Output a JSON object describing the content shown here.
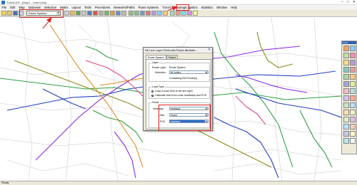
{
  "window": {
    "title": "TransCAD - [Map1 - Live# plan]",
    "buttons": [
      "–",
      "□",
      "✕"
    ]
  },
  "menu": [
    "File",
    "Edit",
    "Map",
    "Dataview",
    "Selection",
    "Matrix",
    "Layout",
    "Tools",
    "Procedures",
    "Networks/Paths",
    "Route Systems",
    "Transit",
    "Routing/Logistics",
    "Statistics",
    "Window",
    "Help"
  ],
  "toolbar": {
    "layer_value": "Route System"
  },
  "palette": {
    "title": "Tools"
  },
  "status": {
    "text": "Ready"
  },
  "dialog": {
    "title": "Fill Line Layer Field with Route Attribute...",
    "tabs": [
      "Route System",
      "Output"
    ],
    "layer_group": "Layer",
    "route_layer_label": "Route Layer",
    "route_layer_value": "Route System",
    "selection_label": "Selection",
    "selection_value": "All routes",
    "containing_text": "Containing 843 Route(s)",
    "load_group": "Load Type",
    "radio1": "Load a route field to the line layer",
    "radio2": "Calculate flow from route headways and PCE",
    "fields_group": "Fields",
    "headway_label": "Headway",
    "headway_value": "headway",
    "units_label": "Units",
    "units_value": "Hours",
    "pce_label": "PCE",
    "pce_value": "headway"
  },
  "colors": {
    "highlight": "#e02020",
    "route_green": "#2ea043",
    "route_blue": "#1f3fbf",
    "route_purple": "#8a2be2",
    "route_olive": "#8b8b1a",
    "route_orange": "#e08a1e"
  }
}
